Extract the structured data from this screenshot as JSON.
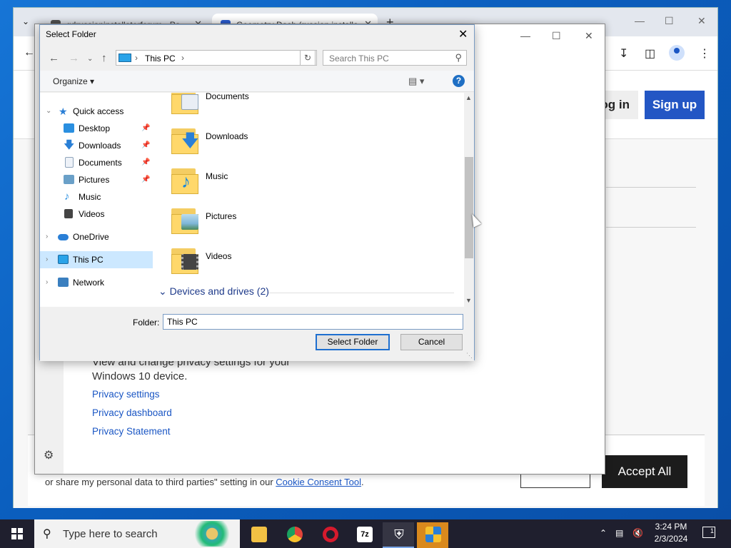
{
  "browser": {
    "tabs": [
      {
        "label": "gdrussianinstallatorforum - Pa"
      },
      {
        "label": "Geometry Dash (russian installa"
      }
    ],
    "new_tab": "+",
    "site": {
      "login": "Log in",
      "signup": "Sign up"
    },
    "cookie": {
      "text_prefix": "or share my personal data to third parties\" setting in our ",
      "link": "Cookie Consent Tool",
      "text_suffix": ".",
      "accept": "Accept All"
    }
  },
  "privacy": {
    "text": "View and change privacy settings for your Windows 10 device.",
    "links": [
      "Privacy settings",
      "Privacy dashboard",
      "Privacy Statement"
    ]
  },
  "dialog": {
    "title": "Select Folder",
    "address": "This PC",
    "search_placeholder": "Search This PC",
    "organize": "Organize",
    "nav": [
      {
        "label": "Quick access",
        "color": "#2a7fd6"
      },
      {
        "label": "Desktop",
        "color": "#2a8fe0",
        "pinned": true
      },
      {
        "label": "Downloads",
        "color": "#2a7fd6",
        "pinned": true
      },
      {
        "label": "Documents",
        "color": "#8fa4bb",
        "pinned": true
      },
      {
        "label": "Pictures",
        "color": "#6aa0c8",
        "pinned": true
      },
      {
        "label": "Music",
        "color": "#2a8fe0"
      },
      {
        "label": "Videos",
        "color": "#444"
      },
      {
        "label": "OneDrive",
        "color": "#2a7fd6"
      },
      {
        "label": "This PC",
        "color": "#2aa3e8",
        "selected": true
      },
      {
        "label": "Network",
        "color": "#3a7fbf"
      }
    ],
    "folders": [
      {
        "label": "Documents",
        "badge": "#e9eef5"
      },
      {
        "label": "Downloads",
        "badge": "#2a7fd6"
      },
      {
        "label": "Music",
        "badge": "#1f8ad8"
      },
      {
        "label": "Pictures",
        "badge": "#7fb7d8"
      },
      {
        "label": "Videos",
        "badge": "#444"
      }
    ],
    "group": "Devices and drives (2)",
    "folder_label": "Folder:",
    "folder_value": "This PC",
    "select_btn": "Select Folder",
    "cancel_btn": "Cancel"
  },
  "taskbar": {
    "search_placeholder": "Type here to search",
    "apps": [
      {
        "name": "file-explorer",
        "color": "#f2c144"
      },
      {
        "name": "chrome",
        "color": "#e2443a"
      },
      {
        "name": "opera",
        "color": "#d51a2d"
      },
      {
        "name": "7zip",
        "color": "#222"
      },
      {
        "name": "security",
        "color": "#fff"
      },
      {
        "name": "uac-shield",
        "color": "#2a7fd6"
      }
    ],
    "time": "3:24 PM",
    "date": "2/3/2024",
    "notifications": "1"
  }
}
